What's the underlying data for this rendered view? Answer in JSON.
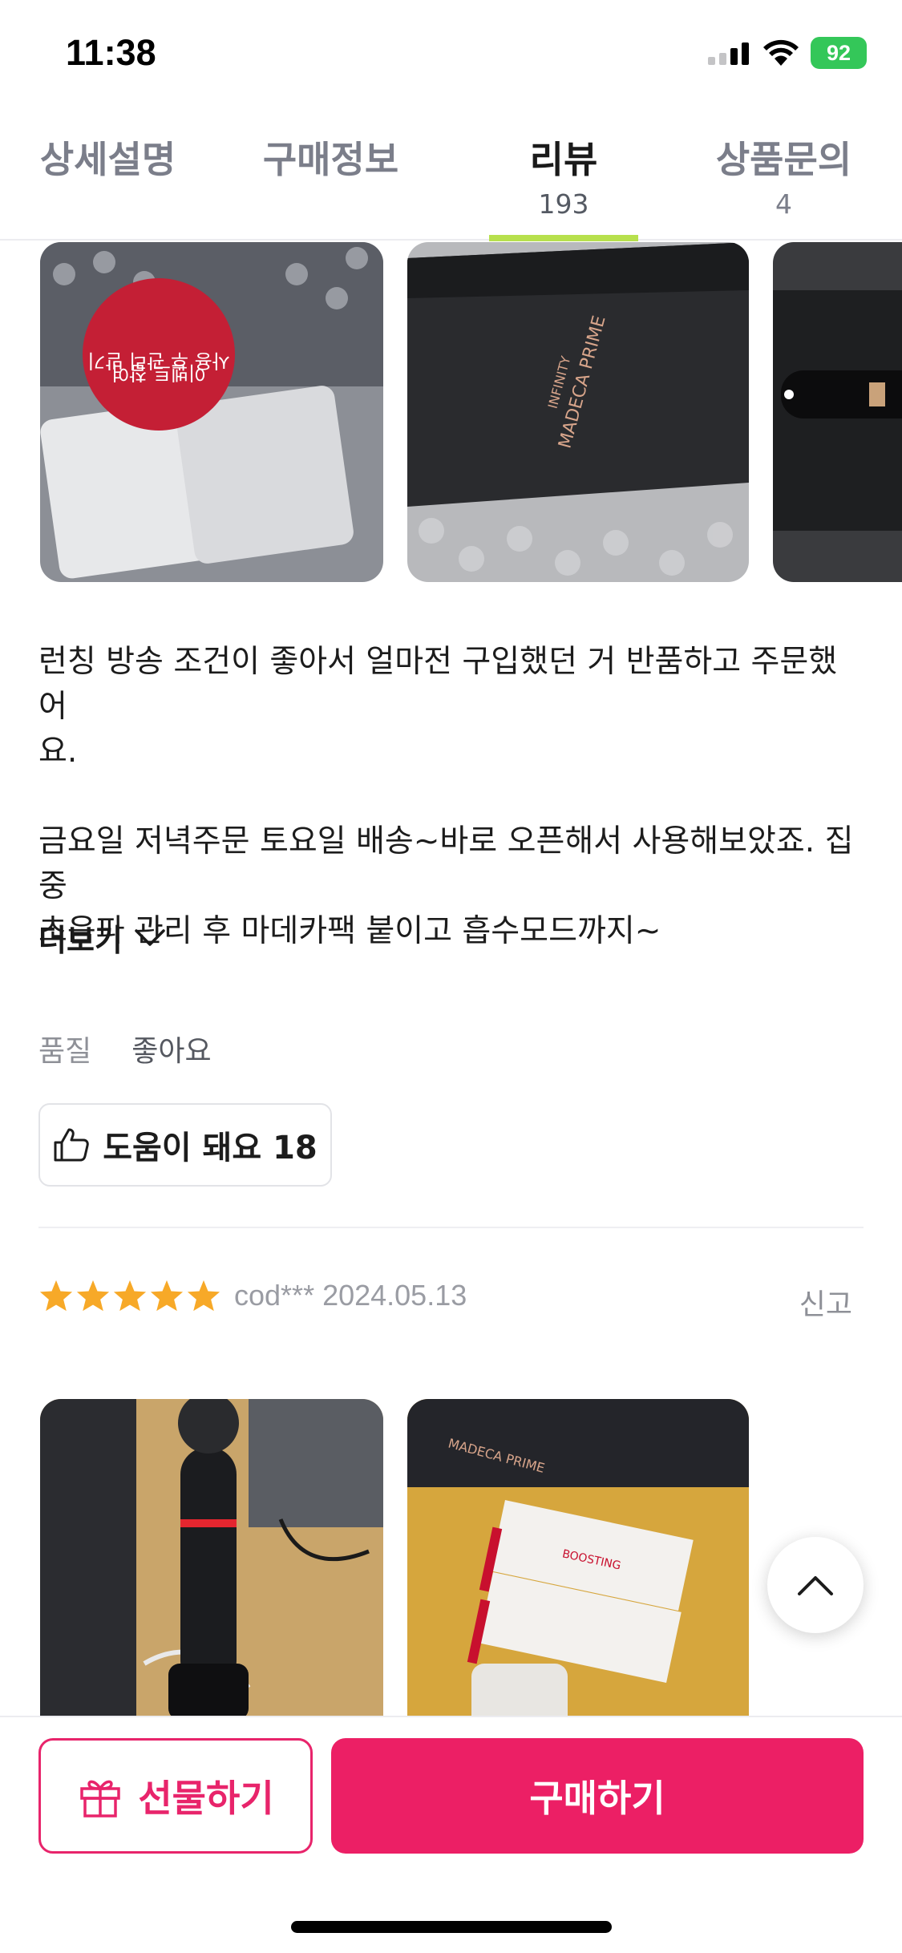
{
  "status_bar": {
    "time": "11:38",
    "battery": "92"
  },
  "tabs": [
    {
      "label": "상세설명",
      "count": ""
    },
    {
      "label": "구매정보",
      "count": ""
    },
    {
      "label": "리뷰",
      "count": "193",
      "active": true
    },
    {
      "label": "상품문의",
      "count": "4"
    }
  ],
  "review1": {
    "paragraph1": "런칭 방송 조건이 좋아서 얼마전 구입했던 거 반품하고 주문했어\n요.",
    "paragraph2": "금요일 저녁주문 토요일 배송~바로 오픈해서 사용해보았죠. 집중\n초음파 관리 후 마데카팩 붙이고 흡수모드까지~",
    "more_label": "더보기",
    "quality_key": "품질",
    "quality_value": "좋아요",
    "helpful_label": "도움이 돼요 18",
    "photo_texts": [
      "MADECA PRIME",
      "INFINITY"
    ]
  },
  "review2": {
    "rating": 5,
    "author_date": "cod*** 2024.05.13",
    "report_label": "신고",
    "photo_texts": [
      "MADECA PRIME",
      "BOOSTING"
    ]
  },
  "bottom": {
    "gift_label": "선물하기",
    "buy_label": "구매하기"
  },
  "colors": {
    "accent": "#ec1f65",
    "star": "#f7a928",
    "tab_indicator": "#b7e04d"
  },
  "icons": [
    "signal-icon",
    "wifi-icon",
    "battery-icon",
    "chevron-down-icon",
    "thumbs-up-icon",
    "star-icon",
    "chevron-up-icon",
    "gift-icon"
  ]
}
